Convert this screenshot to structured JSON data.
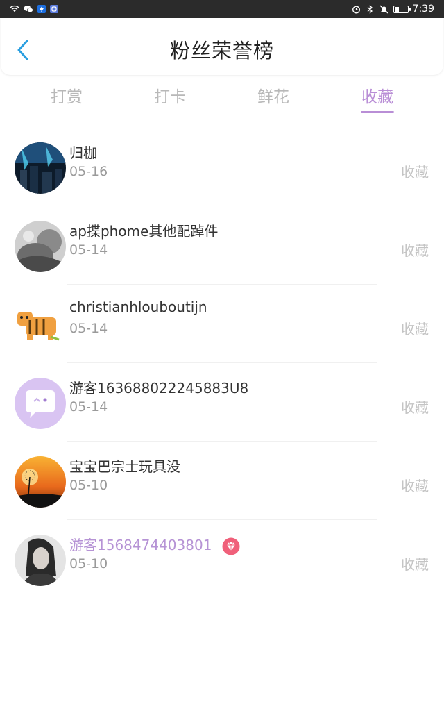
{
  "statusbar": {
    "time": "7:39"
  },
  "header": {
    "title": "粉丝荣誉榜"
  },
  "tabs": [
    {
      "label": "打赏",
      "active": false
    },
    {
      "label": "打卡",
      "active": false
    },
    {
      "label": "鲜花",
      "active": false
    },
    {
      "label": "收藏",
      "active": true
    }
  ],
  "list": [
    {
      "name": "归枷",
      "date": "05-16",
      "action": "收藏",
      "vip": false
    },
    {
      "name": "ap揲phome其他配踔件",
      "date": "05-14",
      "action": "收藏",
      "vip": false
    },
    {
      "name": "christianhlouboutijn",
      "date": "05-14",
      "action": "收藏",
      "vip": false
    },
    {
      "name": "游客163688022245883U8",
      "date": "05-14",
      "action": "收藏",
      "vip": false
    },
    {
      "name": "宝宝巴宗士玩具没",
      "date": "05-10",
      "action": "收藏",
      "vip": false
    },
    {
      "name": "游客1568474403801",
      "date": "05-10",
      "action": "收藏",
      "vip": true
    }
  ],
  "colors": {
    "accent": "#b98ed6",
    "vip_name": "#b693d5",
    "badge": "#f0607a"
  }
}
